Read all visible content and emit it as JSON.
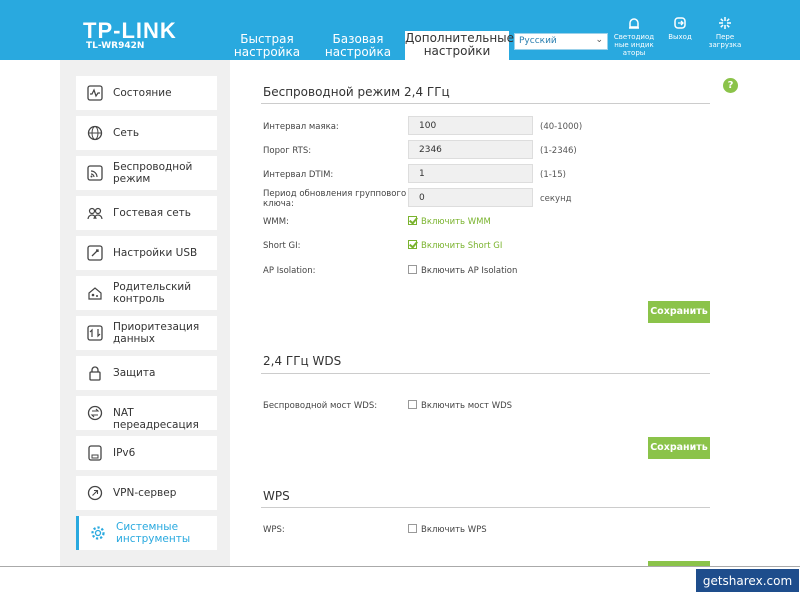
{
  "header": {
    "logo": "TP-LINK",
    "model": "TL-WR942N",
    "tabs": [
      {
        "line1": "Быстрая",
        "line2": "настройка"
      },
      {
        "line1": "Базовая",
        "line2": "настройка"
      },
      {
        "line1": "Дополнительные",
        "line2": "настройки"
      }
    ],
    "language": "Русский",
    "icons": [
      {
        "icon": "led-icon",
        "line1": "Светодиод",
        "line2": "ные индик",
        "line3": "аторы"
      },
      {
        "icon": "logout-icon",
        "line1": "Выход",
        "line2": "",
        "line3": ""
      },
      {
        "icon": "reboot-icon",
        "line1": "Пере",
        "line2": "загрузка",
        "line3": ""
      }
    ],
    "accent": "#29a9df"
  },
  "sidebar": {
    "items": [
      {
        "icon": "pulse-icon",
        "line1": "Состояние",
        "line2": ""
      },
      {
        "icon": "globe-icon",
        "line1": "Сеть",
        "line2": ""
      },
      {
        "icon": "wifi-icon",
        "line1": "Беспроводной",
        "line2": "режим"
      },
      {
        "icon": "guest-icon",
        "line1": "Гостевая сеть",
        "line2": ""
      },
      {
        "icon": "usb-icon",
        "line1": "Настройки USB",
        "line2": ""
      },
      {
        "icon": "parental-icon",
        "line1": "Родительский",
        "line2": "контроль"
      },
      {
        "icon": "priority-icon",
        "line1": "Приоритезация",
        "line2": "данных"
      },
      {
        "icon": "lock-icon",
        "line1": "Защита",
        "line2": ""
      },
      {
        "icon": "nat-icon",
        "line1": "NAT переадресация",
        "line2": ""
      },
      {
        "icon": "ipv6-icon",
        "line1": "IPv6",
        "line2": ""
      },
      {
        "icon": "vpn-icon",
        "line1": "VPN-сервер",
        "line2": ""
      },
      {
        "icon": "gear-icon",
        "line1": "Системные",
        "line2": "инструменты"
      }
    ]
  },
  "wireless24": {
    "title": "Беспроводной режим 2,4 ГГц",
    "beacon": {
      "label": "Интервал маяка:",
      "value": "100",
      "hint": "(40-1000)"
    },
    "rts": {
      "label": "Порог RTS:",
      "value": "2346",
      "hint": "(1-2346)"
    },
    "dtim": {
      "label": "Интервал DTIM:",
      "value": "1",
      "hint": "(1-15)"
    },
    "gkey": {
      "label1": "Период обновления группового",
      "label2": "ключа:",
      "value": "0",
      "hint": "секунд"
    },
    "wmm": {
      "label": "WMM:",
      "text": "Включить WMM",
      "checked": true
    },
    "sgi": {
      "label": "Short GI:",
      "text": "Включить Short GI",
      "checked": true
    },
    "ap": {
      "label": "AP Isolation:",
      "text": "Включить AP Isolation",
      "checked": false
    },
    "save": "Сохранить"
  },
  "wds": {
    "title": "2,4 ГГц WDS",
    "bridge": {
      "label": "Беспроводной мост WDS:",
      "text": "Включить мост WDS",
      "checked": false
    },
    "save": "Сохранить"
  },
  "wps": {
    "title": "WPS",
    "wps": {
      "label": "WPS:",
      "text": "Включить WPS",
      "checked": false
    }
  },
  "help": "?",
  "watermark": "getsharex.com"
}
